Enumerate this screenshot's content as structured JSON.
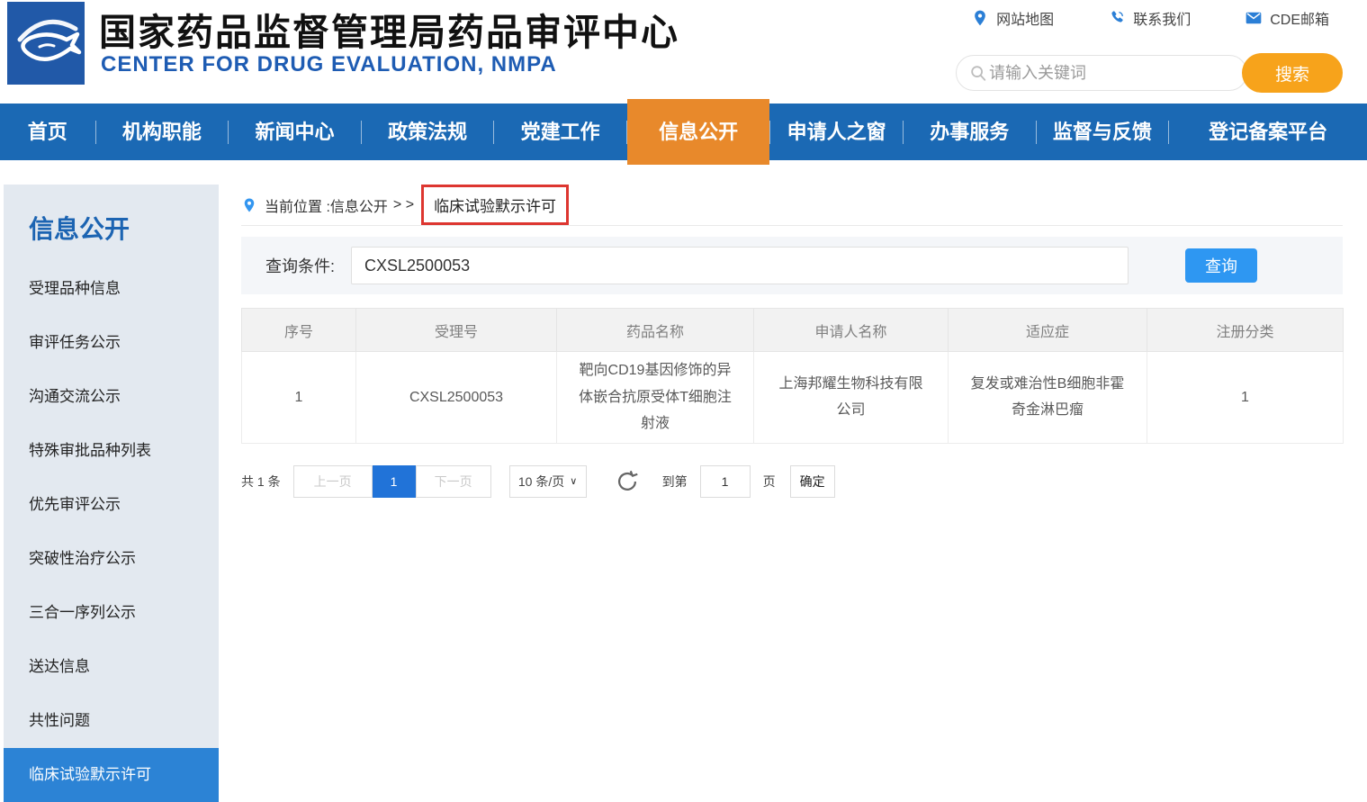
{
  "colors": {
    "nav_blue": "#1b69b4",
    "active_orange": "#e8892b",
    "brand_blue": "#1e5cb3",
    "link_blue": "#2b7fd6",
    "search_orange": "#f7a31b",
    "sidebar_active": "#2c83d5",
    "query_btn": "#2e97f2",
    "page_active": "#2173d8",
    "annotation_red": "#dd3630"
  },
  "header": {
    "title_cn": "国家药品监督管理局药品审评中心",
    "title_en": "CENTER FOR DRUG EVALUATION, NMPA",
    "links": [
      {
        "label": "网站地图",
        "icon": "location-pin-icon"
      },
      {
        "label": "联系我们",
        "icon": "phone-icon"
      },
      {
        "label": "CDE邮箱",
        "icon": "mail-icon"
      }
    ],
    "search": {
      "placeholder": "请输入关键词",
      "button": "搜索"
    }
  },
  "nav": {
    "items": [
      {
        "label": "首页",
        "active": false
      },
      {
        "label": "机构职能",
        "active": false
      },
      {
        "label": "新闻中心",
        "active": false
      },
      {
        "label": "政策法规",
        "active": false
      },
      {
        "label": "党建工作",
        "active": false
      },
      {
        "label": "信息公开",
        "active": true
      },
      {
        "label": "申请人之窗",
        "active": false
      },
      {
        "label": "办事服务",
        "active": false
      },
      {
        "label": "监督与反馈",
        "active": false
      },
      {
        "label": "登记备案平台",
        "active": false
      }
    ]
  },
  "sidebar": {
    "title": "信息公开",
    "items": [
      {
        "label": "受理品种信息",
        "active": false
      },
      {
        "label": "审评任务公示",
        "active": false
      },
      {
        "label": "沟通交流公示",
        "active": false
      },
      {
        "label": "特殊审批品种列表",
        "active": false
      },
      {
        "label": "优先审评公示",
        "active": false
      },
      {
        "label": "突破性治疗公示",
        "active": false
      },
      {
        "label": "三合一序列公示",
        "active": false
      },
      {
        "label": "送达信息",
        "active": false
      },
      {
        "label": "共性问题",
        "active": false
      },
      {
        "label": "临床试验默示许可",
        "active": true
      }
    ]
  },
  "breadcrumb": {
    "prefix": "当前位置 : ",
    "section": "信息公开",
    "separator": "> >",
    "current": "临床试验默示许可"
  },
  "query": {
    "label": "查询条件:",
    "value": "CXSL2500053",
    "button": "查询"
  },
  "table": {
    "columns": [
      "序号",
      "受理号",
      "药品名称",
      "申请人名称",
      "适应症",
      "注册分类"
    ],
    "rows": [
      [
        "1",
        "CXSL2500053",
        "靶向CD19基因修饰的异体嵌合抗原受体T细胞注射液",
        "上海邦耀生物科技有限公司",
        "复发或难治性B细胞非霍奇金淋巴瘤",
        "1"
      ]
    ]
  },
  "pagination": {
    "total": "共 1 条",
    "prev": "上一页",
    "page": "1",
    "next": "下一页",
    "page_size": "10 条/页",
    "goto_label": "到第",
    "goto_value": "1",
    "page_unit": "页",
    "confirm": "确定"
  }
}
